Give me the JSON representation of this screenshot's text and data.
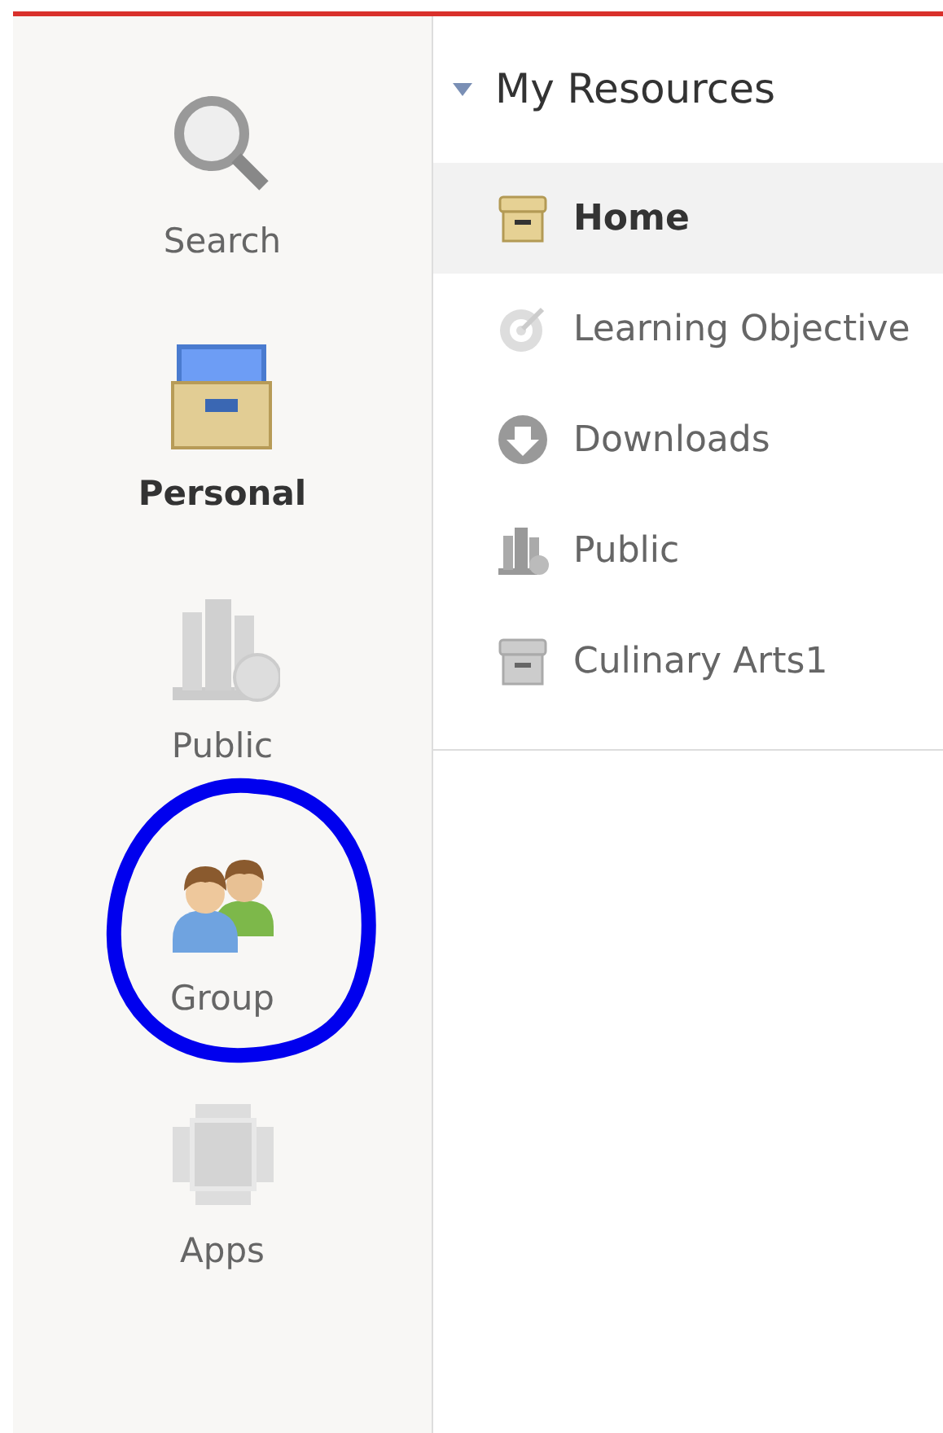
{
  "rail": [
    {
      "kind": "search",
      "label": "Search",
      "selected": false,
      "circled": false
    },
    {
      "kind": "personal",
      "label": "Personal",
      "selected": true,
      "circled": false
    },
    {
      "kind": "public",
      "label": "Public",
      "selected": false,
      "circled": false
    },
    {
      "kind": "group",
      "label": "Group",
      "selected": false,
      "circled": true
    },
    {
      "kind": "apps",
      "label": "Apps",
      "selected": false,
      "circled": false
    }
  ],
  "tree": {
    "title": "My Resources",
    "expanded": true,
    "items": [
      {
        "kind": "home",
        "label": "Home",
        "selected": true
      },
      {
        "kind": "objective",
        "label": "Learning Objective",
        "selected": false
      },
      {
        "kind": "download",
        "label": "Downloads",
        "selected": false
      },
      {
        "kind": "public",
        "label": "Public",
        "selected": false
      },
      {
        "kind": "archive",
        "label": "Culinary Arts1",
        "selected": false
      }
    ]
  }
}
